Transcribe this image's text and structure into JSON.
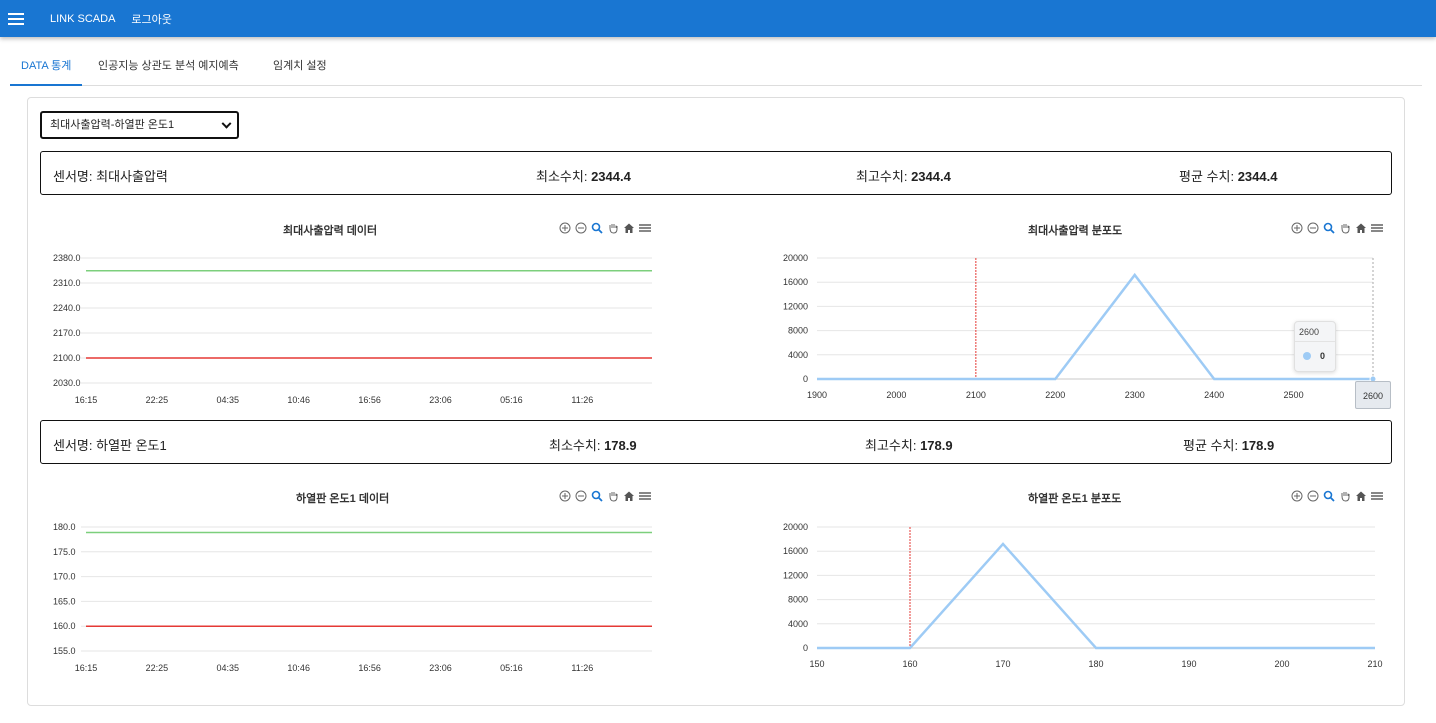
{
  "header": {
    "app_title": "LINK SCADA",
    "logout_label": "로그아웃",
    "bg_color": "#1976d2"
  },
  "tabs": [
    {
      "label": "DATA 통계",
      "active": true
    },
    {
      "label": "인공지능 상관도 분석 예지예측",
      "active": false
    },
    {
      "label": "임계치 설정",
      "active": false
    }
  ],
  "sensor_select": {
    "value": "최대사출압력-하열판 온도1"
  },
  "sections": [
    {
      "info": {
        "name_label": "센서명: ",
        "name": "최대사출압력",
        "min_label": "최소수치: ",
        "min": "2344.4",
        "max_label": "최고수치: ",
        "max": "2344.4",
        "avg_label": "평균 수치: ",
        "avg": "2344.4"
      },
      "line_chart": {
        "title": "최대사출압력 데이터",
        "y_ticks": [
          "2380.0",
          "2310.0",
          "2240.0",
          "2170.0",
          "2100.0",
          "2030.0"
        ],
        "x_ticks": [
          "16:15",
          "22:25",
          "04:35",
          "10:46",
          "16:56",
          "23:06",
          "05:16",
          "11:26"
        ]
      },
      "dist_chart": {
        "title": "최대사출압력 분포도",
        "y_ticks": [
          "20000",
          "16000",
          "12000",
          "8000",
          "4000",
          "0"
        ],
        "x_ticks": [
          "1900",
          "2000",
          "2100",
          "2200",
          "2300",
          "2400",
          "2500",
          "2600"
        ]
      },
      "tooltip": {
        "header": "2600",
        "value": "0"
      },
      "x_hover_label": "2600"
    },
    {
      "info": {
        "name_label": "센서명: ",
        "name": "하열판 온도1",
        "min_label": "최소수치: ",
        "min": "178.9",
        "max_label": "최고수치: ",
        "max": "178.9",
        "avg_label": "평균 수치: ",
        "avg": "178.9"
      },
      "line_chart": {
        "title": "하열판 온도1 데이터",
        "y_ticks": [
          "180.0",
          "175.0",
          "170.0",
          "165.0",
          "160.0",
          "155.0"
        ],
        "x_ticks": [
          "16:15",
          "22:25",
          "04:35",
          "10:46",
          "16:56",
          "23:06",
          "05:16",
          "11:26"
        ]
      },
      "dist_chart": {
        "title": "하열판 온도1 분포도",
        "y_ticks": [
          "20000",
          "16000",
          "12000",
          "8000",
          "4000",
          "0"
        ],
        "x_ticks": [
          "150",
          "160",
          "170",
          "180",
          "190",
          "200",
          "210"
        ]
      }
    }
  ],
  "chart_data": [
    {
      "type": "line",
      "title": "최대사출압력 데이터",
      "ylim": [
        2030,
        2380
      ],
      "series": [
        {
          "name": "",
          "color": "#7ccf7c",
          "values": [
            2344.4,
            2344.4
          ]
        },
        {
          "name": "",
          "color": "#e53935",
          "values": [
            2100,
            2100
          ]
        }
      ]
    },
    {
      "type": "line",
      "title": "최대사출압력 분포도",
      "x": [
        1900,
        2000,
        2100,
        2200,
        2300,
        2400,
        2500,
        2600
      ],
      "ylim": [
        0,
        20000
      ],
      "series": [
        {
          "name": "",
          "color": "#9ecbf5",
          "values": [
            0,
            0,
            0,
            0,
            17200,
            0,
            0,
            0
          ]
        }
      ],
      "marker_line": {
        "x": 2100,
        "color": "#e53935"
      }
    },
    {
      "type": "line",
      "title": "하열판 온도1 데이터",
      "ylim": [
        155,
        180
      ],
      "series": [
        {
          "name": "",
          "color": "#7ccf7c",
          "values": [
            178.9,
            178.9
          ]
        },
        {
          "name": "",
          "color": "#e53935",
          "values": [
            160,
            160
          ]
        }
      ]
    },
    {
      "type": "line",
      "title": "하열판 온도1 분포도",
      "x": [
        150,
        160,
        170,
        180,
        190,
        200,
        210
      ],
      "ylim": [
        0,
        20000
      ],
      "series": [
        {
          "name": "",
          "color": "#9ecbf5",
          "values": [
            0,
            0,
            17200,
            0,
            0,
            0,
            0
          ]
        }
      ],
      "marker_line": {
        "x": 160,
        "color": "#e53935"
      }
    }
  ]
}
